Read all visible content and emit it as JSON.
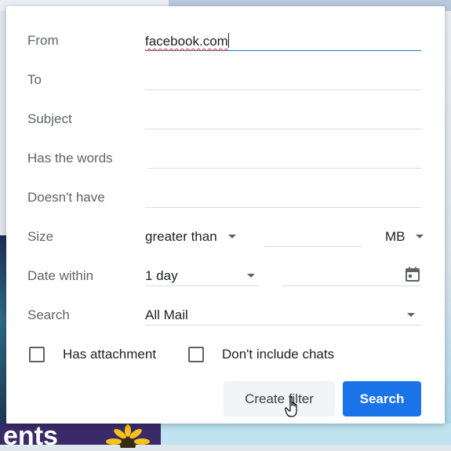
{
  "filter_dialog": {
    "from": {
      "label": "From",
      "value": "facebook.com"
    },
    "to": {
      "label": "To",
      "value": ""
    },
    "subject": {
      "label": "Subject",
      "value": ""
    },
    "has_words": {
      "label": "Has the words",
      "value": ""
    },
    "doesnt_have": {
      "label": "Doesn't have",
      "value": ""
    },
    "size": {
      "label": "Size",
      "comparator": "greater than",
      "value": "",
      "unit": "MB"
    },
    "date_within": {
      "label": "Date within",
      "range": "1 day",
      "date": "",
      "icon": "calendar-icon"
    },
    "search_in": {
      "label": "Search",
      "value": "All Mail"
    },
    "has_attachment": {
      "label": "Has attachment",
      "checked": false
    },
    "dont_include_chats": {
      "label": "Don't include chats",
      "checked": false
    },
    "buttons": {
      "create_filter": "Create filter",
      "search": "Search"
    }
  },
  "background": {
    "partial_text": "ents"
  },
  "colors": {
    "primary": "#1a73e8",
    "label": "#5f6368",
    "divider": "#dadce0",
    "spell_error": "#d93025"
  }
}
